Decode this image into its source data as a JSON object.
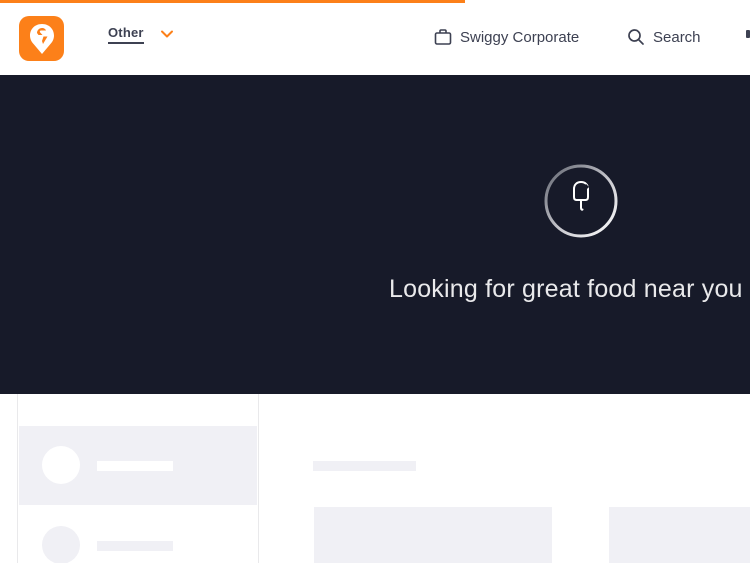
{
  "page": {
    "loading_progress_percent": 62
  },
  "header": {
    "logo": "swiggy-logo",
    "location_label": "Other",
    "nav": {
      "corporate_label": "Swiggy Corporate",
      "search_label": "Search"
    }
  },
  "hero": {
    "loading_text": "Looking for great food near you"
  },
  "colors": {
    "brand": "#fc8019",
    "hero_bg": "#171a29",
    "text_dark": "#3d4152",
    "skeleton": "#f0f0f5"
  },
  "icons": {
    "logo": "swiggy-logo-icon",
    "dropdown": "chevron-down-icon",
    "corporate": "briefcase-icon",
    "search": "search-icon",
    "loader": "popsicle-icon"
  }
}
